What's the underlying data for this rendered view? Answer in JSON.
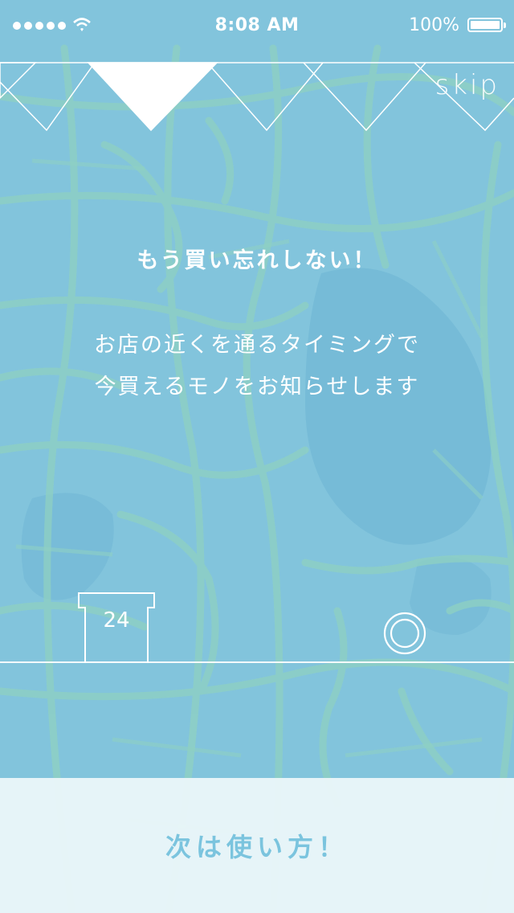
{
  "status_bar": {
    "time": "8:08 AM",
    "battery": "100%",
    "signal_icon": "signal-dots-icon",
    "wifi_icon": "wifi-icon",
    "battery_icon": "battery-icon"
  },
  "pager": {
    "page_count": 4,
    "current_page": 1,
    "skip_label": "skip"
  },
  "onboarding": {
    "headline": "もう買い忘れしない！",
    "description_line1": "お店の近くを通るタイミングで",
    "description_line2": "今買えるモノをお知らせします"
  },
  "icons": {
    "calendar_icon": "calendar-icon",
    "calendar_number": "24",
    "location_icon": "location-ring-icon"
  },
  "next_button": {
    "label": "次は使い方！"
  },
  "colors": {
    "background": "#82c4dc",
    "map_roads": "#8ed0c0",
    "next_bar_bg": "#ecf6fa",
    "next_label": "#7bc4de"
  }
}
